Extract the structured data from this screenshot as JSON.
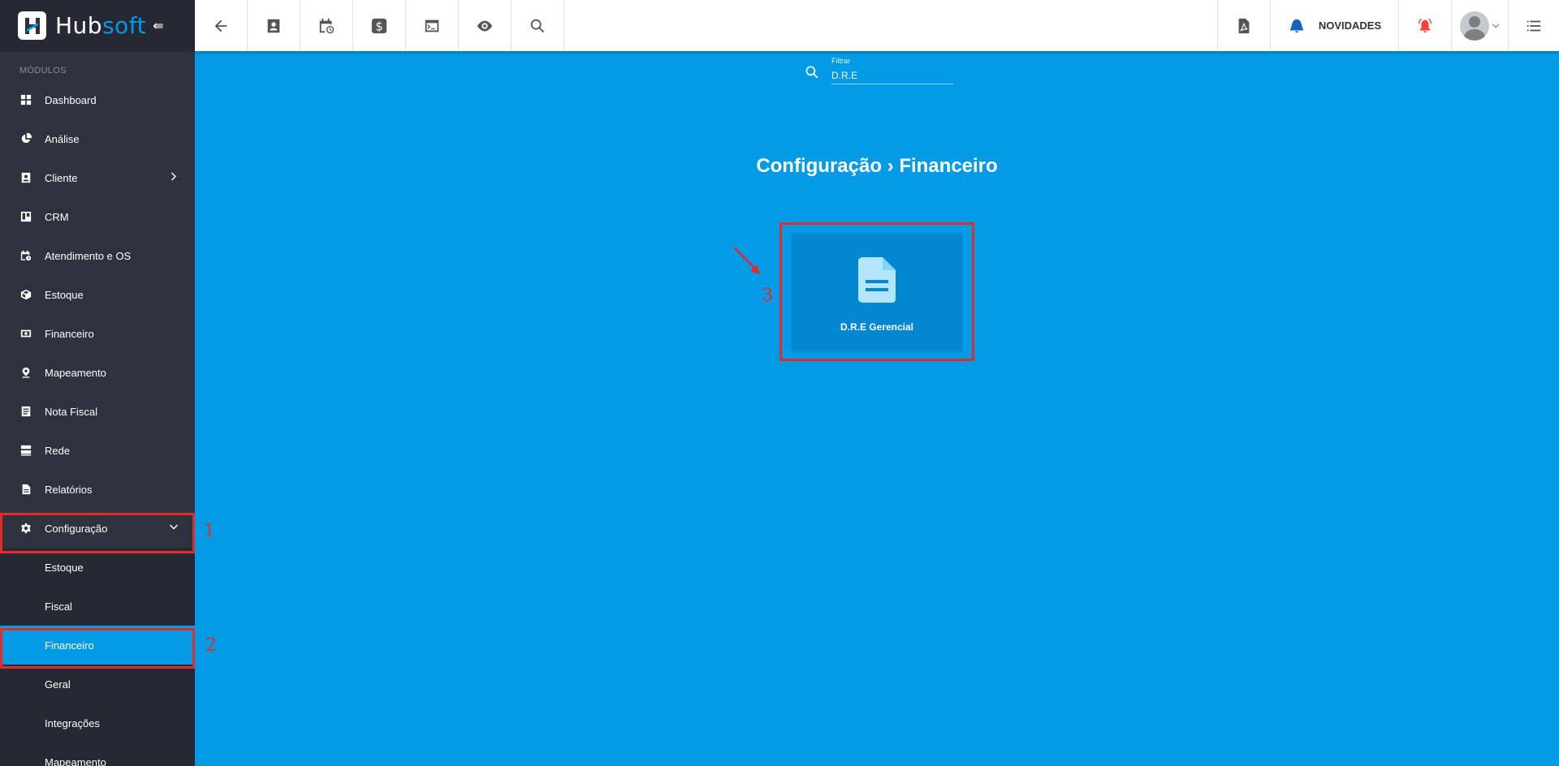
{
  "app": {
    "brand_hub": "Hub",
    "brand_soft": "soft",
    "toggle_glyph": "⇚"
  },
  "sidebar": {
    "section_label": "MÓDULOS",
    "items": [
      {
        "label": "Dashboard",
        "icon": "dashboard-icon"
      },
      {
        "label": "Análise",
        "icon": "pie-chart-icon"
      },
      {
        "label": "Cliente",
        "icon": "contact-card-icon"
      },
      {
        "label": "CRM",
        "icon": "trello-board-icon"
      },
      {
        "label": "Atendimento e OS",
        "icon": "calendar-clock-icon"
      },
      {
        "label": "Estoque",
        "icon": "package-icon"
      },
      {
        "label": "Financeiro",
        "icon": "money-icon"
      },
      {
        "label": "Mapeamento",
        "icon": "map-pin-icon"
      },
      {
        "label": "Nota Fiscal",
        "icon": "receipt-icon"
      },
      {
        "label": "Rede",
        "icon": "server-icon"
      },
      {
        "label": "Relatórios",
        "icon": "document-icon"
      },
      {
        "label": "Configuração",
        "icon": "gear-icon"
      }
    ],
    "config_sub": [
      {
        "label": "Estoque"
      },
      {
        "label": "Fiscal"
      },
      {
        "label": "Financeiro"
      },
      {
        "label": "Geral"
      },
      {
        "label": "Integrações"
      },
      {
        "label": "Mapeamento"
      }
    ]
  },
  "topbar": {
    "news_label": "NOVIDADES"
  },
  "filter": {
    "label": "Filtrar",
    "value": "D.R.E"
  },
  "breadcrumb": {
    "text": "Configuração › Financeiro"
  },
  "card": {
    "label": "D.R.E Gerencial"
  },
  "annotations": {
    "one": "1",
    "two": "2",
    "three": "3"
  },
  "colors": {
    "accent": "#039be5",
    "sidebar": "#2d323e",
    "highlight": "#e52a2a",
    "card": "#0288d1"
  }
}
